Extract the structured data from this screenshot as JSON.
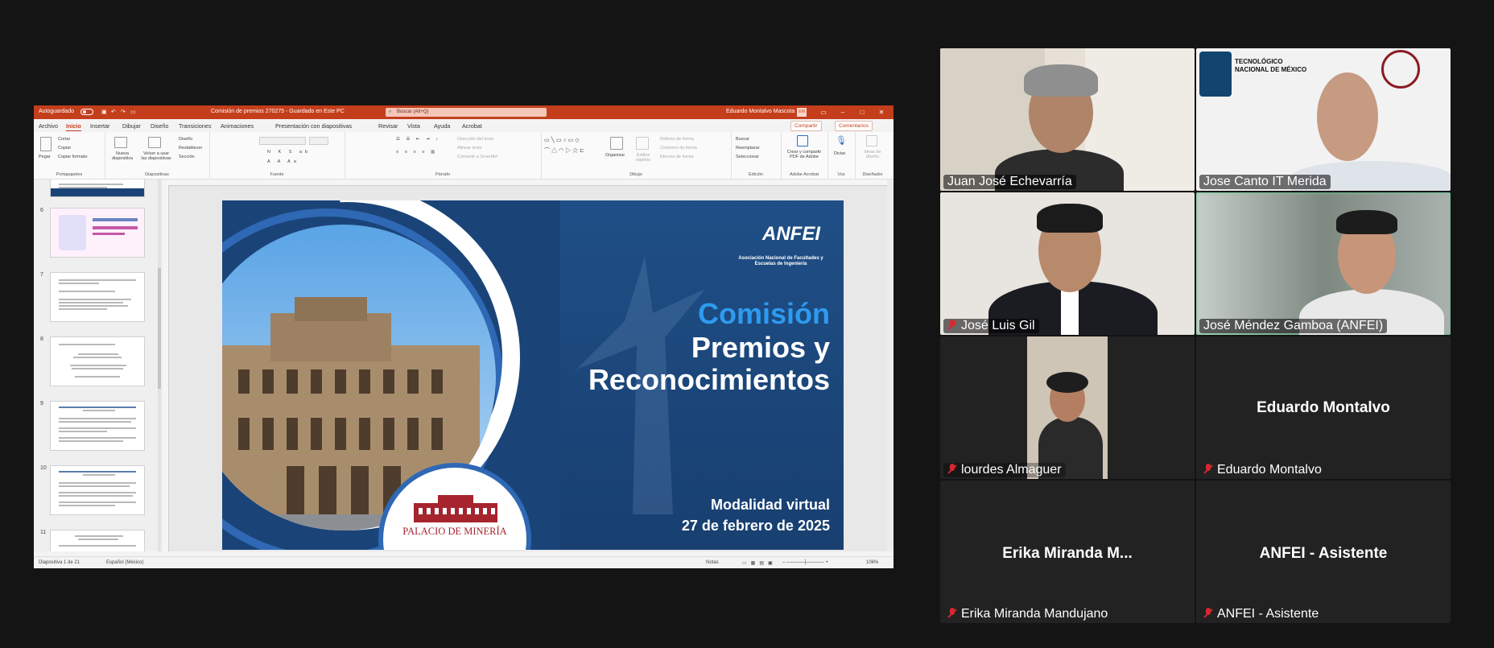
{
  "ppt": {
    "autosave": "Autoguardado",
    "filename": "Comisión de premios 270275  -  Guardado en Este PC",
    "search": "Buscar (Alt+Q)",
    "user": "Eduardo Montalvo Mascota",
    "user_initials": "EM",
    "menu": [
      "Archivo",
      "Inicio",
      "Insertar",
      "Dibujar",
      "Diseño",
      "Transiciones",
      "Animaciones",
      "Presentación con diapositivas",
      "Revisar",
      "Vista",
      "Ayuda",
      "Acrobat"
    ],
    "share": "Compartir",
    "comments": "Comentarios",
    "ribbon": {
      "portapapeles": "Portapapeles",
      "pegar": "Pegar",
      "cortar": "Cortar",
      "copiar": "Copiar",
      "copiar_formato": "Copiar formato",
      "diapositivas": "Diapositivas",
      "nueva": "Nueva diapositiva",
      "volver": "Volver a usar las diapositivas",
      "diseno": "Diseño",
      "restablecer": "Restablecer",
      "seccion": "Sección",
      "fuente": "Fuente",
      "parrafo": "Párrafo",
      "direccion": "Dirección del texto",
      "alinear": "Alinear texto",
      "smartart": "Convertir a SmartArt",
      "dibujo": "Dibujo",
      "organizar": "Organizar",
      "estilos": "Estilos rápidos",
      "relleno": "Relleno de forma",
      "contorno": "Contorno de forma",
      "efectos": "Efectos de forma",
      "buscar": "Buscar",
      "reemplazar": "Reemplazar",
      "seleccionar": "Seleccionar",
      "edicion": "Edición",
      "crear_pdf": "Crear y compartir PDF de Adobe",
      "adobe": "Adobe Acrobat",
      "dictar": "Dictar",
      "voz": "Voz",
      "ideas": "Ideas de diseño",
      "disenador": "Diseñador"
    },
    "thumbnails": [
      "6",
      "7",
      "8",
      "9",
      "10",
      "11"
    ],
    "slide": {
      "anfei": "ANFEI",
      "anfei_sub": "Asociación Nacional de Facultades y Escuelas de Ingeniería",
      "line1": "Comisión",
      "line2": "Premios y",
      "line3": "Reconocimientos",
      "modalidad": "Modalidad virtual",
      "fecha": "27 de febrero de 2025",
      "palacio": "PALACIO DE MINERÍA"
    },
    "status": {
      "slide_count": "Diapositiva 1 de 21",
      "language": "Español (México)",
      "notes": "Notas",
      "zoom": "106%"
    }
  },
  "participants": [
    {
      "name": "Juan José Echevarría",
      "muted": false
    },
    {
      "name": "Jose Canto IT Merida",
      "muted": false
    },
    {
      "name": "José Luis Gil",
      "muted": true
    },
    {
      "name": "José Méndez Gamboa (ANFEI)",
      "muted": false,
      "active": true
    },
    {
      "name": "lourdes Almaguer",
      "muted": true
    },
    {
      "name": "Eduardo Montalvo",
      "muted": true,
      "display": "Eduardo Montalvo"
    },
    {
      "name": "Erika Miranda Mandujano",
      "muted": true,
      "display": "Erika  Miranda  M..."
    },
    {
      "name": "ANFEI - Asistente",
      "muted": true,
      "display": "ANFEI - Asistente"
    }
  ],
  "tecnm_logo": "TECNOLÓGICO NACIONAL DE MÉXICO",
  "colors": {
    "ppt_accent": "#c43e1c",
    "active_speaker": "#4fd38a",
    "muted": "#d9272e",
    "slide_blue": "#1a4478",
    "slide_title_blue": "#2d9bf0"
  }
}
